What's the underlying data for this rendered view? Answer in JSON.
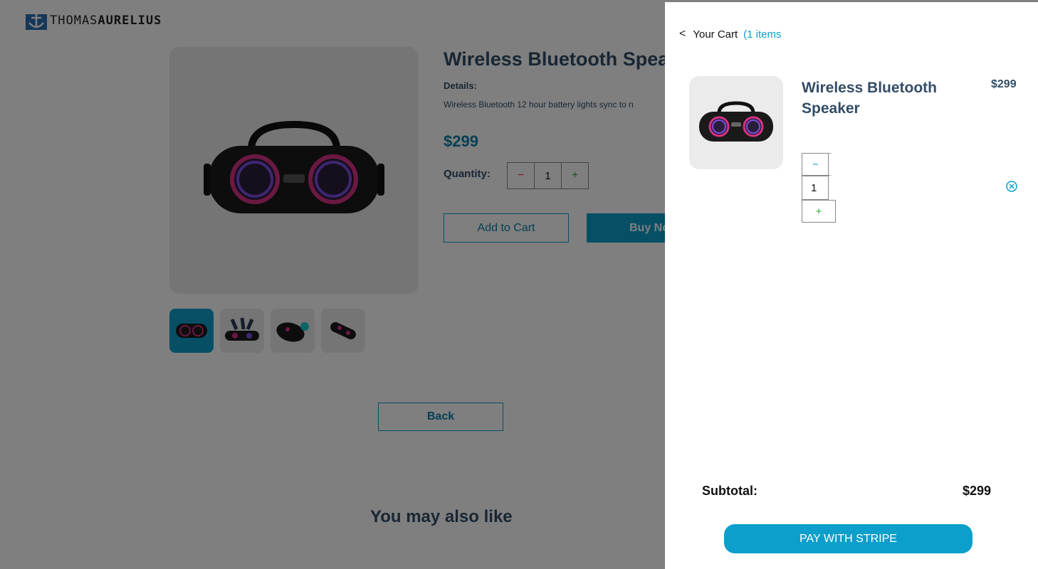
{
  "brand": {
    "text_light": "THOMAS",
    "text_bold": "AURELIUS"
  },
  "product": {
    "title": "Wireless Bluetooth Spea",
    "details_label": "Details:",
    "details_text": "Wireless Bluetooth 12 hour battery lights sync to n",
    "price": "$299",
    "quantity_label": "Quantity:",
    "qty_minus": "−",
    "qty_value": "1",
    "qty_plus": "+",
    "add_to_cart": "Add to Cart",
    "buy_now": "Buy No"
  },
  "back_label": "Back",
  "also_like_heading": "You may also like",
  "cart": {
    "back_chevron": "<",
    "title": "Your Cart",
    "count": "(1 items",
    "items": [
      {
        "name": "Wireless Bluetooth Speaker",
        "price": "$299",
        "qty_minus": "−",
        "qty_value": "1",
        "qty_plus": "+"
      }
    ],
    "subtotal_label": "Subtotal:",
    "subtotal_value": "$299",
    "pay_button": "PAY WITH STRIPE"
  },
  "icons": {
    "cart_back": "chevron-left-icon",
    "remove": "close-circle-icon",
    "logo": "anchor-logo-icon"
  },
  "colors": {
    "accent": "#0c9fcb",
    "text_dark": "#324d67",
    "overlay": "rgba(0,0,0,0.5)",
    "plus_green": "#31a831"
  }
}
